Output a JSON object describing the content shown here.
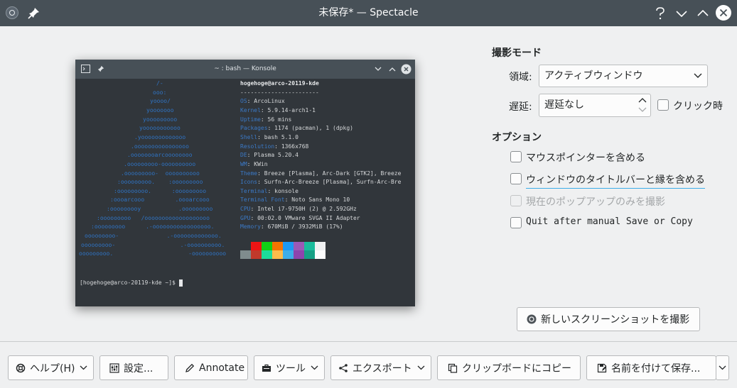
{
  "window": {
    "title": "未保存* — Spectacle"
  },
  "screenshot": {
    "konsole_title": "~ : bash — Konsole",
    "logo": [
      "/-",
      "ooo:",
      "yoooo/",
      "yooooooo",
      "yooooooooo",
      "yooooooooooo",
      ".yooooooooooooo",
      ".oooooooooooooooo",
      ".oooooooarcoooooooo",
      ".ooooooooo-oooooooooo",
      ".ooooooooo-  oooooooooo",
      ":ooooooooo.    :ooooooooo",
      ":ooooooooo.      :ooooooooo",
      ":oooarcooo         .oooarcooo",
      ":ooooooooy           .ooooooooo",
      ":ooooooooo   /ooooooooooooooooooo",
      ":ooooooooo      .-ooooooooooooooooo.",
      "ooooooooo-              .-ooooooooooooo.",
      "ooooooooo-                   .-oooooooooo.",
      "ooooooooo.                      -oooooooooo"
    ],
    "header": "hogehoge@arco-20119-kde",
    "dashes": "-----------------------",
    "info": [
      {
        "k": "OS",
        "v": "ArcoLinux"
      },
      {
        "k": "Kernel",
        "v": "5.9.14-arch1-1"
      },
      {
        "k": "Uptime",
        "v": "56 mins"
      },
      {
        "k": "Packages",
        "v": "1174 (pacman), 1 (dpkg)"
      },
      {
        "k": "Shell",
        "v": "bash 5.1.0"
      },
      {
        "k": "Resolution",
        "v": "1366x768"
      },
      {
        "k": "DE",
        "v": "Plasma 5.20.4"
      },
      {
        "k": "WM",
        "v": "KWin"
      },
      {
        "k": "Theme",
        "v": "Breeze [Plasma], Arc-Dark [GTK2], Breeze"
      },
      {
        "k": "Icons",
        "v": "Surfn-Arc-Breeze [Plasma], Surfn-Arc-Bre"
      },
      {
        "k": "Terminal",
        "v": "konsole"
      },
      {
        "k": "Terminal Font",
        "v": "Noto Sans Mono 10"
      },
      {
        "k": "CPU",
        "v": "Intel i7-9750H (2) @ 2.592GHz"
      },
      {
        "k": "GPU",
        "v": "00:02.0 VMware SVGA II Adapter"
      },
      {
        "k": "Memory",
        "v": "670MiB / 3932MiB (17%)"
      }
    ],
    "swatches_row1": [
      "#31363b",
      "#ed1515",
      "#11d116",
      "#f67400",
      "#1d99f3",
      "#9b59b6",
      "#1abc9c",
      "#eff0f1"
    ],
    "swatches_row2": [
      "#7f8c8d",
      "#c0392b",
      "#1cdc9a",
      "#fdbc4b",
      "#3daee9",
      "#8e44ad",
      "#16a085",
      "#fcfcfc"
    ],
    "prompt": "[hogehoge@arco-20119-kde ~]$ "
  },
  "capture": {
    "section_title": "撮影モード",
    "area_label": "領域:",
    "area_value": "アクティブウィンドウ",
    "delay_label": "遅延:",
    "delay_value": "遅延なし",
    "on_click_label": "クリック時"
  },
  "options": {
    "section_title": "オプション",
    "items": [
      {
        "label": "マウスポインターを含める",
        "checked": false,
        "enabled": true
      },
      {
        "label": "ウィンドウのタイトルバーと縁を含める",
        "checked": false,
        "enabled": true
      },
      {
        "label": "現在のポップアップのみを撮影",
        "checked": false,
        "enabled": false
      },
      {
        "label": "Quit after manual Save or Copy",
        "checked": false,
        "enabled": true
      }
    ]
  },
  "new_screenshot_button": "新しいスクリーンショットを撮影",
  "bottom": {
    "help": "ヘルプ(H)",
    "settings": "設定...",
    "annotate": "Annotate",
    "tools": "ツール",
    "export": "エクスポート",
    "copy": "クリップボードにコピー",
    "save_as": "名前を付けて保存..."
  }
}
